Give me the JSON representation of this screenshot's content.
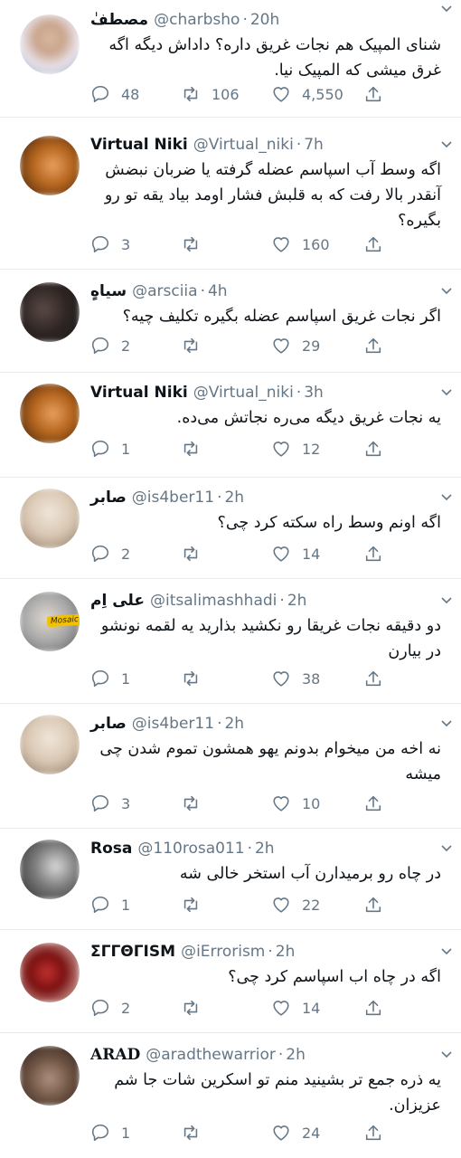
{
  "tweets": [
    {
      "name": "مصطفٰ",
      "handle": "@charbsho",
      "time": "20h",
      "text": "شنای المپیک هم نجات غریق داره؟ داداش دیگه اگه غرق میشی که المپیک نیا.",
      "replies": "48",
      "retweets": "106",
      "likes": "4,550",
      "avatar_colors": [
        "#c9a58c",
        "#e8cfc0",
        "#9fb6c8"
      ]
    },
    {
      "name": "Virtual Niki",
      "handle": "@Virtual_niki",
      "time": "7h",
      "text": "اگه وسط آب اسپاسم عضله گرفته یا ضربان نبضش آنقدر بالا رفت که به قلبش فشار اومد بیاد یقه تو رو بگیره؟",
      "replies": "3",
      "retweets": "",
      "likes": "160",
      "avatar_colors": [
        "#b5651d",
        "#e8a060",
        "#3a2010"
      ]
    },
    {
      "name": "سیاهٍ",
      "handle": "@arsciia",
      "time": "4h",
      "text": "اگر نجات غریق اسپاسم عضله بگیره تکلیف چیه؟",
      "replies": "2",
      "retweets": "",
      "likes": "29",
      "avatar_colors": [
        "#1a1a1a",
        "#5a4a45",
        "#2d2422"
      ]
    },
    {
      "name": "Virtual Niki",
      "handle": "@Virtual_niki",
      "time": "3h",
      "text": "یه نجات غریق دیگه می‌ره نجاتش می‌ده.",
      "replies": "1",
      "retweets": "",
      "likes": "12",
      "avatar_colors": [
        "#b5651d",
        "#e8a060",
        "#3a2010"
      ]
    },
    {
      "name": "صابر",
      "handle": "@is4ber11",
      "time": "2h",
      "text": "اگه اونم وسط راه سکته کرد چی؟",
      "replies": "2",
      "retweets": "",
      "likes": "14",
      "avatar_colors": [
        "#d9c7b3",
        "#f0e6da",
        "#8c7a66"
      ]
    },
    {
      "name": "علی اِم",
      "handle": "@itsalimashhadi",
      "time": "2h",
      "text": "دو دقیقه نجات غریقا رو نکشید بذارید یه لقمه نونشو در بیارن",
      "replies": "1",
      "retweets": "",
      "likes": "38",
      "avatar_colors": [
        "#a8a8a8",
        "#e0d8d0",
        "#5c5c5c"
      ],
      "avatar_tag": "Mosaic"
    },
    {
      "name": "صابر",
      "handle": "@is4ber11",
      "time": "2h",
      "text": "نه اخه من میخوام بدونم یهو همشون تموم شدن چی میشه",
      "replies": "3",
      "retweets": "",
      "likes": "10",
      "avatar_colors": [
        "#d9c7b3",
        "#f0e6da",
        "#8c7a66"
      ]
    },
    {
      "name": "Rosa",
      "handle": "@110rosa011",
      "time": "2h",
      "text": "در چاه رو برمیدارن آب استخر خالی شه",
      "replies": "1",
      "retweets": "",
      "likes": "22",
      "avatar_colors": [
        "#2a2a2a",
        "#d8d8d8",
        "#7a7a7a"
      ]
    },
    {
      "name": "ΣΓΓΘΓΙSM",
      "handle": "@iErrorism",
      "time": "2h",
      "text": "اگه در چاه اب اسپاسم کرد چی؟",
      "replies": "2",
      "retweets": "",
      "likes": "14",
      "avatar_colors": [
        "#7a1010",
        "#c03030",
        "#e8d0c8"
      ]
    },
    {
      "name": "ARAD",
      "handle": "@aradthewarrior",
      "time": "2h",
      "text": "یه ذره جمع تر بشینید منم تو اسکرین شات جا شم عزیزان.",
      "replies": "1",
      "retweets": "",
      "likes": "24",
      "avatar_colors": [
        "#6a5040",
        "#b09080",
        "#302020"
      ]
    }
  ],
  "colors": {
    "text": "#0f1419",
    "muted": "#657786",
    "divider": "#e6ecf0"
  }
}
